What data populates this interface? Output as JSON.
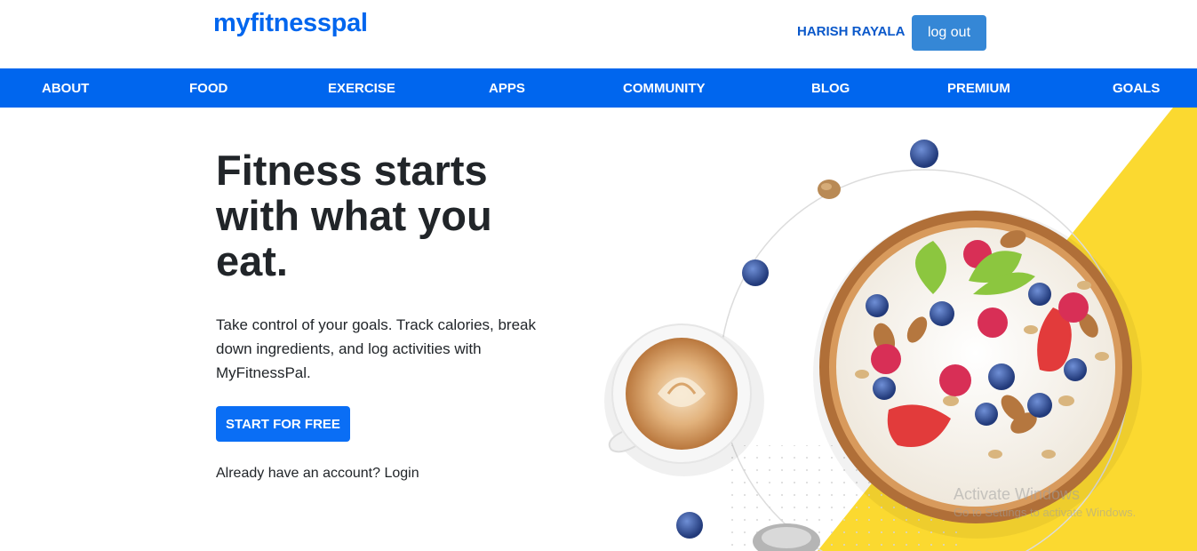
{
  "header": {
    "logo": "myfitnesspal",
    "user_name": "HARISH RAYALA",
    "logout_label": "log out"
  },
  "nav": {
    "items": [
      "ABOUT",
      "FOOD",
      "EXERCISE",
      "APPS",
      "COMMUNITY",
      "BLOG",
      "PREMIUM",
      "GOALS"
    ]
  },
  "hero": {
    "title": "Fitness starts with what you eat.",
    "text": "Take control of your goals. Track calories, break down ingredients, and log activities with MyFitnessPal.",
    "cta_label": "START FOR FREE",
    "login_prompt": "Already have an account? Login"
  },
  "watermark": {
    "title": "Activate Windows",
    "subtitle": "Go to Settings to activate Windows."
  },
  "colors": {
    "brand_blue": "#0066ee",
    "button_blue": "#0a6ef5",
    "logout_blue": "#3587d6",
    "accent_yellow": "#fbd930"
  }
}
